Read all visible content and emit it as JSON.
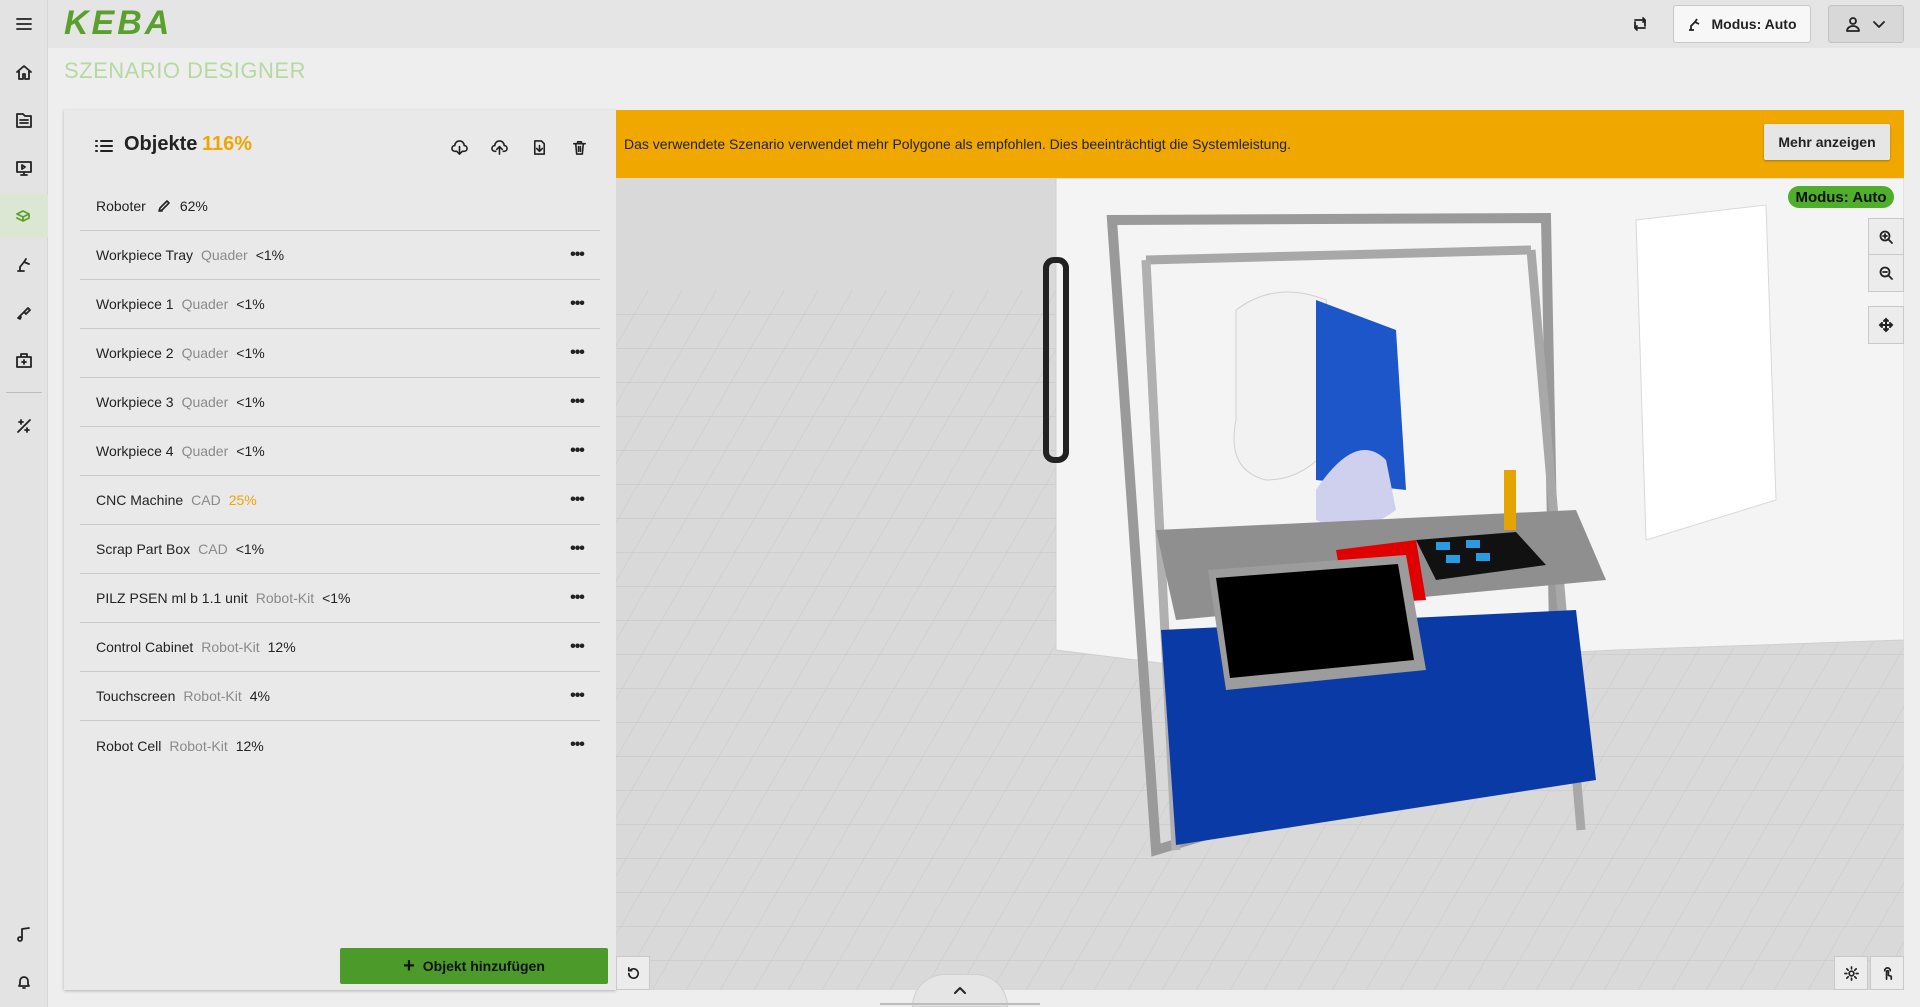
{
  "app": {
    "brand": "KEBA",
    "page_title": "SZENARIO DESIGNER"
  },
  "header": {
    "mode_label": "Modus: Auto"
  },
  "nav": [
    "menu-icon",
    "home-icon",
    "document-icon",
    "monitor-icon",
    "scenario-icon",
    "robot-arm-icon",
    "tool-icon",
    "toolbox-icon",
    "calibrate-icon",
    "music-note-icon",
    "bell-icon"
  ],
  "panel": {
    "title": "Objekte",
    "total_pct": "116%",
    "objects": [
      {
        "name": "Roboter",
        "type": "",
        "pct": "62%",
        "editable": true
      },
      {
        "name": "Workpiece Tray",
        "type": "Quader",
        "pct": "<1%"
      },
      {
        "name": "Workpiece 1",
        "type": "Quader",
        "pct": "<1%"
      },
      {
        "name": "Workpiece 2",
        "type": "Quader",
        "pct": "<1%"
      },
      {
        "name": "Workpiece 3",
        "type": "Quader",
        "pct": "<1%"
      },
      {
        "name": "Workpiece 4",
        "type": "Quader",
        "pct": "<1%"
      },
      {
        "name": "CNC Machine",
        "type": "CAD",
        "pct": "25%",
        "warn": true
      },
      {
        "name": "Scrap Part Box",
        "type": "CAD",
        "pct": "<1%"
      },
      {
        "name": "PILZ PSEN ml b 1.1 unit",
        "type": "Robot-Kit",
        "pct": "<1%"
      },
      {
        "name": "Control Cabinet",
        "type": "Robot-Kit",
        "pct": "12%"
      },
      {
        "name": "Touchscreen",
        "type": "Robot-Kit",
        "pct": "4%"
      },
      {
        "name": "Robot Cell",
        "type": "Robot-Kit",
        "pct": "12%"
      }
    ],
    "add_label": "Objekt hinzufügen"
  },
  "viewport": {
    "warning": "Das verwendete Szenario verwendet mehr Polygone als empfohlen. Dies beeinträchtigt die Systemleistung.",
    "more_label": "Mehr anzeigen",
    "mode_badge": "Modus: Auto"
  },
  "colors": {
    "accent": "#5aa02c",
    "warning": "#f0a800",
    "cabinet_blue": "#0a3aa5",
    "mode_green": "#4fae2c"
  }
}
